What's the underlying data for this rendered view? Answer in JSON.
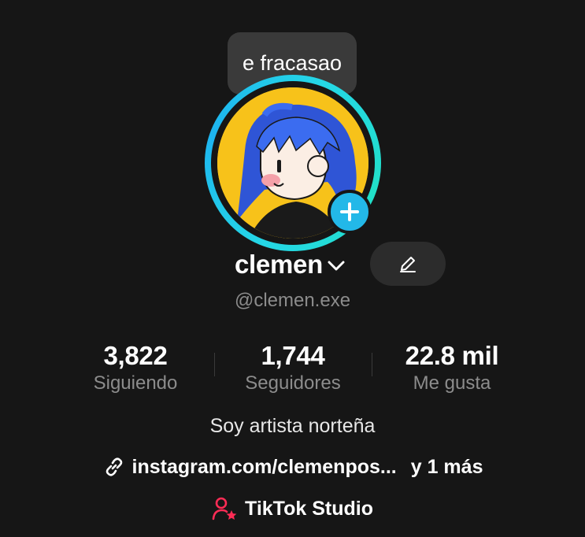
{
  "profile": {
    "note": "e fracasao",
    "display_name": "clemen",
    "username": "@clemen.exe",
    "bio": "Soy artista norteña",
    "link_text": "instagram.com/clemenpos...",
    "link_more": "y 1 más",
    "studio_label": "TikTok Studio"
  },
  "stats": [
    {
      "value": "3,822",
      "label": "Siguiendo"
    },
    {
      "value": "1,744",
      "label": "Seguidores"
    },
    {
      "value": "22.8 mil",
      "label": "Me gusta"
    }
  ],
  "colors": {
    "background": "#161616",
    "ring": "#25d7e6",
    "plus_badge": "#23b8e8",
    "avatar_bg": "#f7c21a",
    "studio_icon": "#fe2c55",
    "muted_text": "#8c8c8c"
  },
  "icons": {
    "chevron": "chevron-down-icon",
    "edit": "pencil-icon",
    "plus": "plus-icon",
    "link": "link-icon",
    "studio": "person-star-icon"
  }
}
